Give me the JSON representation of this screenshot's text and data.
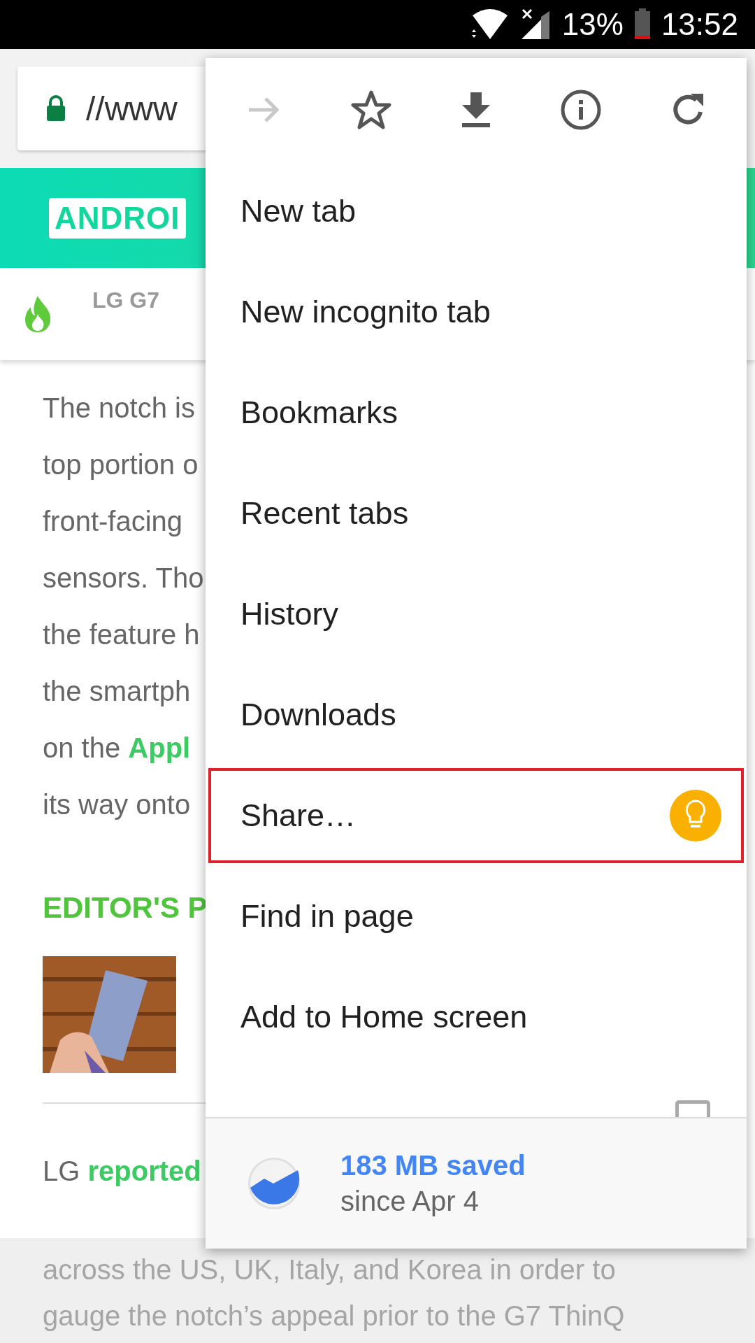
{
  "status_bar": {
    "battery": "13%",
    "time": "13:52"
  },
  "url_bar": {
    "url": "//www"
  },
  "site_header": {
    "logo": "ANDROI"
  },
  "nav": {
    "items": [
      "LG G7"
    ]
  },
  "article": {
    "lines": [
      "The notch is",
      "top portion o",
      "front-facing",
      "sensors. Tho",
      "the feature h",
      "the smartph",
      "on the **Appl**",
      "its way onto"
    ],
    "heading": "EDITOR'S P",
    "thumbnail": {
      "kind": "picture"
    },
    "after_lines": [
      "LG **reported**"
    ],
    "lower_lines": [
      "across the US, UK, Italy, and Korea in order to",
      "gauge the notch’s appeal prior to the G7 ThinQ"
    ]
  },
  "menu": {
    "icons": [
      {
        "kind": "forward",
        "disabled": true
      },
      {
        "kind": "bookmark",
        "disabled": false
      },
      {
        "kind": "download",
        "disabled": false
      },
      {
        "kind": "info",
        "disabled": false
      },
      {
        "kind": "refresh",
        "disabled": false
      }
    ],
    "items": [
      {
        "label": "New tab",
        "highlighted": false,
        "tip": false
      },
      {
        "label": "New incognito tab",
        "highlighted": false,
        "tip": false
      },
      {
        "label": "Bookmarks",
        "highlighted": false,
        "tip": false
      },
      {
        "label": "Recent tabs",
        "highlighted": false,
        "tip": false
      },
      {
        "label": "History",
        "highlighted": false,
        "tip": false
      },
      {
        "label": "Downloads",
        "highlighted": false,
        "tip": false
      },
      {
        "label": "Share…",
        "highlighted": true,
        "tip": true
      },
      {
        "label": "Find in page",
        "highlighted": false,
        "tip": false
      },
      {
        "label": "Add to Home screen",
        "highlighted": false,
        "tip": false
      }
    ],
    "desktop_site": {
      "checked": false
    },
    "footer": {
      "title": "183 MB saved",
      "subtitle": "since Apr 4"
    }
  }
}
